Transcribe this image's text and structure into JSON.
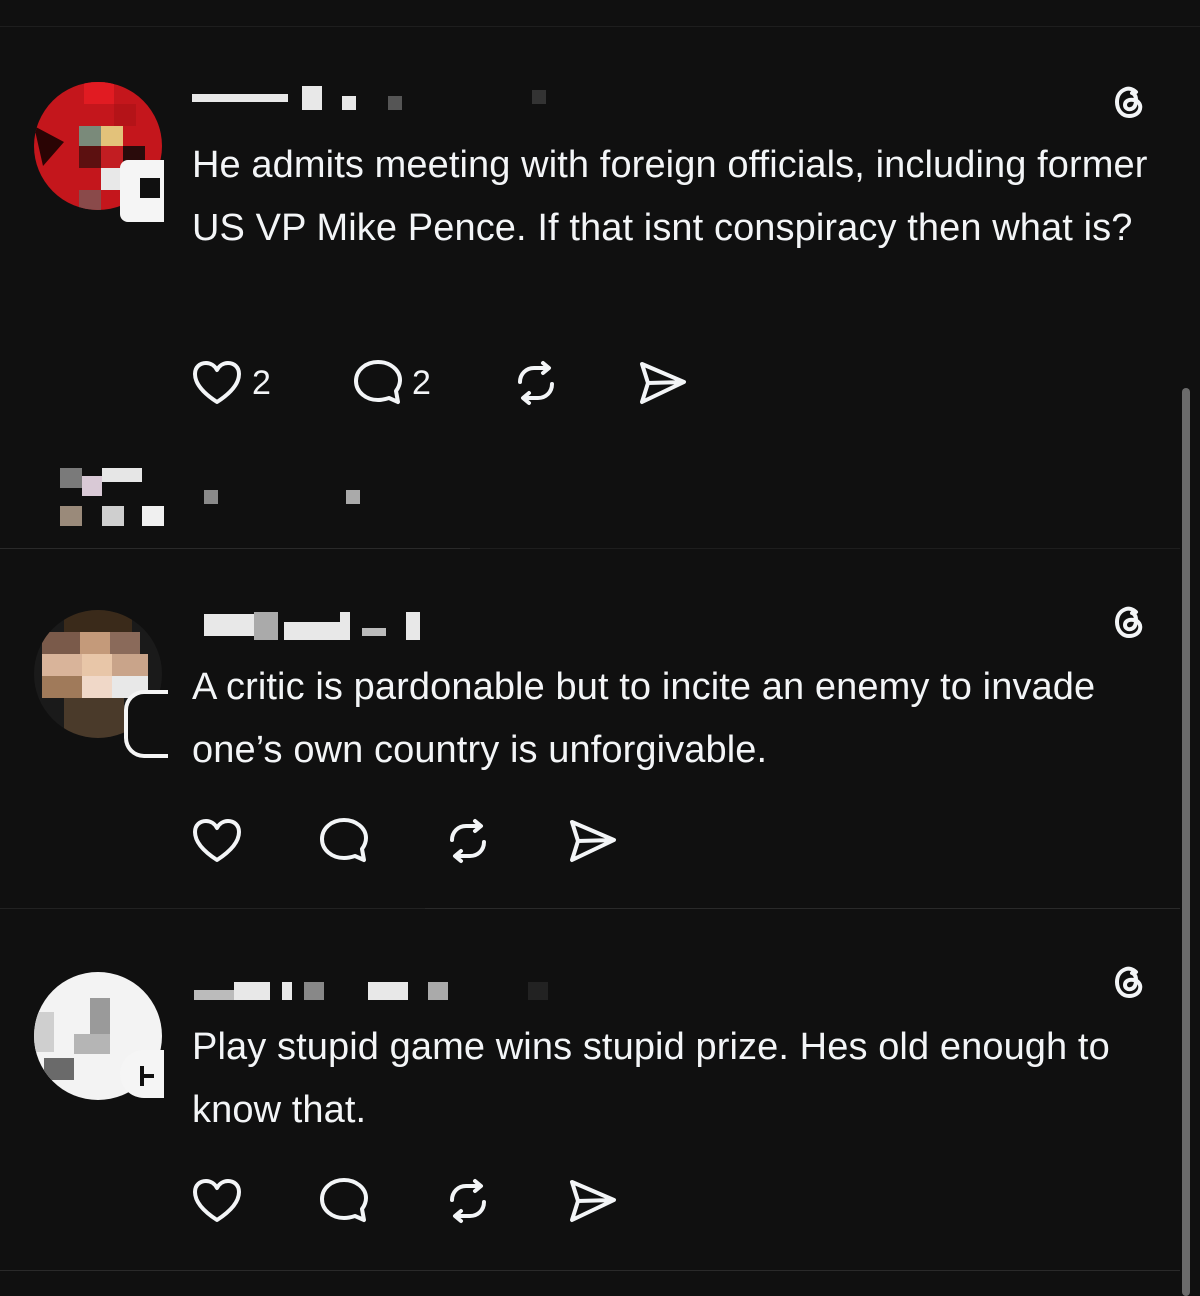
{
  "posts": [
    {
      "text": "He admits meeting with foreign officials, including former US VP Mike Pence. If that isnt conspiracy then what is?",
      "likes": "2",
      "replies": "2"
    },
    {
      "text": "A critic is pardonable but to incite an enemy to invade one’s own country is unforgivable.",
      "likes": "",
      "replies": ""
    },
    {
      "text": "Play stupid game wins stupid prize. Hes old enough to know that.",
      "likes": "",
      "replies": ""
    }
  ],
  "icons": {
    "like": "heart-icon",
    "reply": "comment-icon",
    "repost": "repost-icon",
    "share": "share-icon",
    "brand": "threads-logo-icon"
  },
  "colors": {
    "background": "#101010",
    "text": "#f3f5f7",
    "divider": "#2a2a2a",
    "avatar1_accent": "#d0171b"
  }
}
